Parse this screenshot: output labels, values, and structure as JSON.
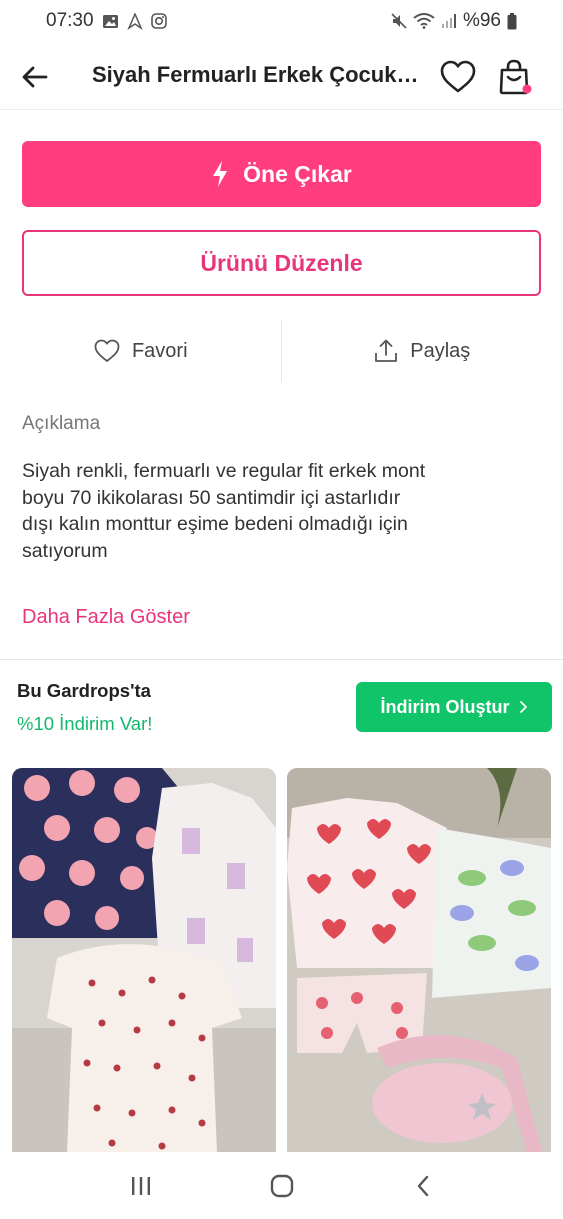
{
  "status_bar": {
    "time": "07:30",
    "battery": "%96"
  },
  "header": {
    "title": "Siyah Fermuarlı Erkek Çocuk Mont"
  },
  "buttons": {
    "feature_label": "Öne Çıkar",
    "edit_label": "Ürünü Düzenle"
  },
  "actions": {
    "favorite_label": "Favori",
    "share_label": "Paylaş"
  },
  "description": {
    "label": "Açıklama",
    "text": "Siyah renkli, fermuarlı ve regular fit erkek  mont\nboyu 70 ikikolarası  50 santimdir  içi  astarlıdır\ndışı kalın  monttur  eşime bedeni olmadığı için\nsatıyorum",
    "more_label": "Daha Fazla Göster"
  },
  "promo": {
    "title": "Bu Gardrops'ta",
    "subtitle": "%10 İndirim Var!",
    "button_label": "İndirim Oluştur"
  },
  "colors": {
    "brand_pink": "#ff3d7f",
    "brand_pink_text": "#e9357a",
    "promo_green": "#10c46a",
    "promo_text_green": "#14b86c"
  },
  "icons": {
    "back": "arrow-left-icon",
    "favorite": "heart-icon",
    "cart": "shopping-bag-icon",
    "feature": "lightning-icon",
    "share": "share-icon"
  }
}
